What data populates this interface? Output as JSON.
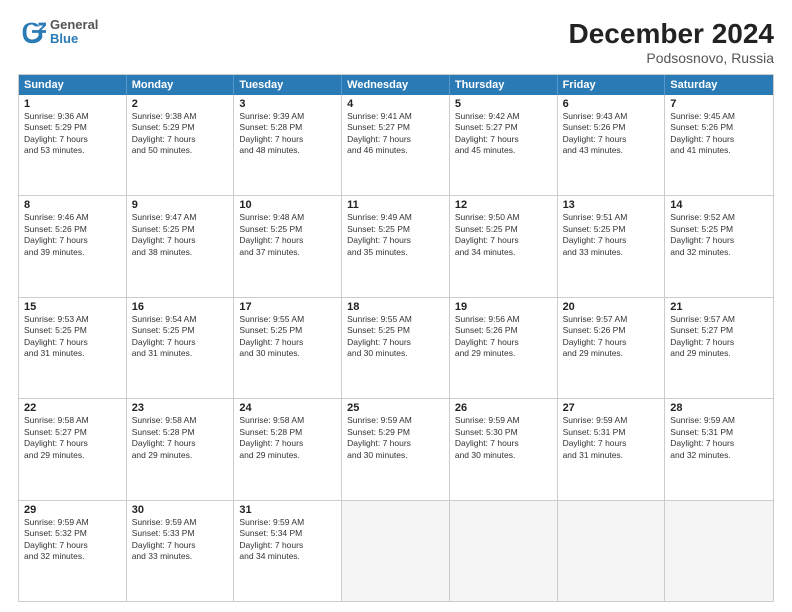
{
  "title": "December 2024",
  "subtitle": "Podsosnovo, Russia",
  "logo": {
    "line1": "General",
    "line2": "Blue"
  },
  "days": [
    "Sunday",
    "Monday",
    "Tuesday",
    "Wednesday",
    "Thursday",
    "Friday",
    "Saturday"
  ],
  "weeks": [
    [
      {
        "day": "1",
        "sunrise": "Sunrise: 9:36 AM",
        "sunset": "Sunset: 5:29 PM",
        "daylight": "Daylight: 7 hours",
        "minutes": "and 53 minutes."
      },
      {
        "day": "2",
        "sunrise": "Sunrise: 9:38 AM",
        "sunset": "Sunset: 5:29 PM",
        "daylight": "Daylight: 7 hours",
        "minutes": "and 50 minutes."
      },
      {
        "day": "3",
        "sunrise": "Sunrise: 9:39 AM",
        "sunset": "Sunset: 5:28 PM",
        "daylight": "Daylight: 7 hours",
        "minutes": "and 48 minutes."
      },
      {
        "day": "4",
        "sunrise": "Sunrise: 9:41 AM",
        "sunset": "Sunset: 5:27 PM",
        "daylight": "Daylight: 7 hours",
        "minutes": "and 46 minutes."
      },
      {
        "day": "5",
        "sunrise": "Sunrise: 9:42 AM",
        "sunset": "Sunset: 5:27 PM",
        "daylight": "Daylight: 7 hours",
        "minutes": "and 45 minutes."
      },
      {
        "day": "6",
        "sunrise": "Sunrise: 9:43 AM",
        "sunset": "Sunset: 5:26 PM",
        "daylight": "Daylight: 7 hours",
        "minutes": "and 43 minutes."
      },
      {
        "day": "7",
        "sunrise": "Sunrise: 9:45 AM",
        "sunset": "Sunset: 5:26 PM",
        "daylight": "Daylight: 7 hours",
        "minutes": "and 41 minutes."
      }
    ],
    [
      {
        "day": "8",
        "sunrise": "Sunrise: 9:46 AM",
        "sunset": "Sunset: 5:26 PM",
        "daylight": "Daylight: 7 hours",
        "minutes": "and 39 minutes."
      },
      {
        "day": "9",
        "sunrise": "Sunrise: 9:47 AM",
        "sunset": "Sunset: 5:25 PM",
        "daylight": "Daylight: 7 hours",
        "minutes": "and 38 minutes."
      },
      {
        "day": "10",
        "sunrise": "Sunrise: 9:48 AM",
        "sunset": "Sunset: 5:25 PM",
        "daylight": "Daylight: 7 hours",
        "minutes": "and 37 minutes."
      },
      {
        "day": "11",
        "sunrise": "Sunrise: 9:49 AM",
        "sunset": "Sunset: 5:25 PM",
        "daylight": "Daylight: 7 hours",
        "minutes": "and 35 minutes."
      },
      {
        "day": "12",
        "sunrise": "Sunrise: 9:50 AM",
        "sunset": "Sunset: 5:25 PM",
        "daylight": "Daylight: 7 hours",
        "minutes": "and 34 minutes."
      },
      {
        "day": "13",
        "sunrise": "Sunrise: 9:51 AM",
        "sunset": "Sunset: 5:25 PM",
        "daylight": "Daylight: 7 hours",
        "minutes": "and 33 minutes."
      },
      {
        "day": "14",
        "sunrise": "Sunrise: 9:52 AM",
        "sunset": "Sunset: 5:25 PM",
        "daylight": "Daylight: 7 hours",
        "minutes": "and 32 minutes."
      }
    ],
    [
      {
        "day": "15",
        "sunrise": "Sunrise: 9:53 AM",
        "sunset": "Sunset: 5:25 PM",
        "daylight": "Daylight: 7 hours",
        "minutes": "and 31 minutes."
      },
      {
        "day": "16",
        "sunrise": "Sunrise: 9:54 AM",
        "sunset": "Sunset: 5:25 PM",
        "daylight": "Daylight: 7 hours",
        "minutes": "and 31 minutes."
      },
      {
        "day": "17",
        "sunrise": "Sunrise: 9:55 AM",
        "sunset": "Sunset: 5:25 PM",
        "daylight": "Daylight: 7 hours",
        "minutes": "and 30 minutes."
      },
      {
        "day": "18",
        "sunrise": "Sunrise: 9:55 AM",
        "sunset": "Sunset: 5:25 PM",
        "daylight": "Daylight: 7 hours",
        "minutes": "and 30 minutes."
      },
      {
        "day": "19",
        "sunrise": "Sunrise: 9:56 AM",
        "sunset": "Sunset: 5:26 PM",
        "daylight": "Daylight: 7 hours",
        "minutes": "and 29 minutes."
      },
      {
        "day": "20",
        "sunrise": "Sunrise: 9:57 AM",
        "sunset": "Sunset: 5:26 PM",
        "daylight": "Daylight: 7 hours",
        "minutes": "and 29 minutes."
      },
      {
        "day": "21",
        "sunrise": "Sunrise: 9:57 AM",
        "sunset": "Sunset: 5:27 PM",
        "daylight": "Daylight: 7 hours",
        "minutes": "and 29 minutes."
      }
    ],
    [
      {
        "day": "22",
        "sunrise": "Sunrise: 9:58 AM",
        "sunset": "Sunset: 5:27 PM",
        "daylight": "Daylight: 7 hours",
        "minutes": "and 29 minutes."
      },
      {
        "day": "23",
        "sunrise": "Sunrise: 9:58 AM",
        "sunset": "Sunset: 5:28 PM",
        "daylight": "Daylight: 7 hours",
        "minutes": "and 29 minutes."
      },
      {
        "day": "24",
        "sunrise": "Sunrise: 9:58 AM",
        "sunset": "Sunset: 5:28 PM",
        "daylight": "Daylight: 7 hours",
        "minutes": "and 29 minutes."
      },
      {
        "day": "25",
        "sunrise": "Sunrise: 9:59 AM",
        "sunset": "Sunset: 5:29 PM",
        "daylight": "Daylight: 7 hours",
        "minutes": "and 30 minutes."
      },
      {
        "day": "26",
        "sunrise": "Sunrise: 9:59 AM",
        "sunset": "Sunset: 5:30 PM",
        "daylight": "Daylight: 7 hours",
        "minutes": "and 30 minutes."
      },
      {
        "day": "27",
        "sunrise": "Sunrise: 9:59 AM",
        "sunset": "Sunset: 5:31 PM",
        "daylight": "Daylight: 7 hours",
        "minutes": "and 31 minutes."
      },
      {
        "day": "28",
        "sunrise": "Sunrise: 9:59 AM",
        "sunset": "Sunset: 5:31 PM",
        "daylight": "Daylight: 7 hours",
        "minutes": "and 32 minutes."
      }
    ],
    [
      {
        "day": "29",
        "sunrise": "Sunrise: 9:59 AM",
        "sunset": "Sunset: 5:32 PM",
        "daylight": "Daylight: 7 hours",
        "minutes": "and 32 minutes."
      },
      {
        "day": "30",
        "sunrise": "Sunrise: 9:59 AM",
        "sunset": "Sunset: 5:33 PM",
        "daylight": "Daylight: 7 hours",
        "minutes": "and 33 minutes."
      },
      {
        "day": "31",
        "sunrise": "Sunrise: 9:59 AM",
        "sunset": "Sunset: 5:34 PM",
        "daylight": "Daylight: 7 hours",
        "minutes": "and 34 minutes."
      },
      null,
      null,
      null,
      null
    ]
  ]
}
